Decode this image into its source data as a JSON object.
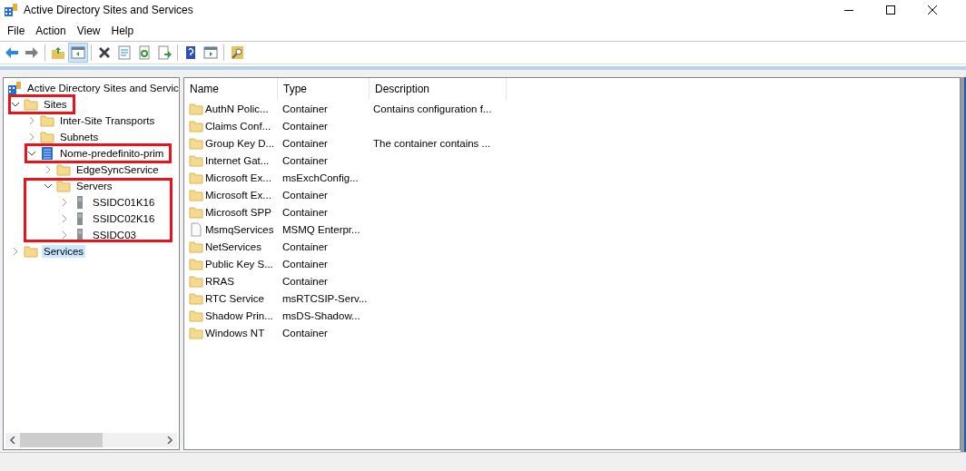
{
  "window": {
    "title": "Active Directory Sites and Services"
  },
  "menu": [
    "File",
    "Action",
    "View",
    "Help"
  ],
  "toolbar": [
    {
      "kind": "back",
      "selected": false
    },
    {
      "kind": "forward",
      "selected": false
    },
    {
      "kind": "sep"
    },
    {
      "kind": "up",
      "selected": false
    },
    {
      "kind": "pane",
      "selected": true
    },
    {
      "kind": "sep"
    },
    {
      "kind": "delete",
      "selected": false
    },
    {
      "kind": "properties",
      "selected": false
    },
    {
      "kind": "refresh",
      "selected": false
    },
    {
      "kind": "export",
      "selected": false
    },
    {
      "kind": "sep"
    },
    {
      "kind": "help",
      "selected": false
    },
    {
      "kind": "action-pane",
      "selected": false
    },
    {
      "kind": "sep"
    },
    {
      "kind": "find",
      "selected": false
    }
  ],
  "tree": {
    "label": "Active Directory Sites and Servic",
    "children": [
      {
        "label": "Sites",
        "kind": "folder",
        "expanded": true,
        "selected": false,
        "highlighted": true,
        "children": [
          {
            "label": "Inter-Site Transports",
            "kind": "folder",
            "expanded": false,
            "selected": false
          },
          {
            "label": "Subnets",
            "kind": "folder",
            "expanded": false,
            "selected": false
          },
          {
            "label": "Nome-predefinito-prim",
            "kind": "site",
            "expanded": true,
            "selected": false,
            "highlighted": true,
            "children": [
              {
                "label": "EdgeSyncService",
                "kind": "folder",
                "expanded": false,
                "selected": false
              },
              {
                "label": "Servers",
                "kind": "folder",
                "expanded": true,
                "selected": false,
                "branch_highlighted": true,
                "children": [
                  {
                    "label": "SSIDC01K16",
                    "kind": "server",
                    "expanded": false,
                    "selected": false
                  },
                  {
                    "label": "SSIDC02K16",
                    "kind": "server",
                    "expanded": false,
                    "selected": false
                  },
                  {
                    "label": "SSIDC03",
                    "kind": "server",
                    "expanded": false,
                    "selected": false
                  }
                ]
              }
            ]
          }
        ]
      },
      {
        "label": "Services",
        "kind": "folder",
        "expanded": false,
        "selected": true
      }
    ]
  },
  "table": {
    "columns": [
      "Name",
      "Type",
      "Description"
    ],
    "rows": [
      {
        "kind": "folder",
        "cells": [
          "AuthN Polic...",
          "Container",
          "Contains configuration f..."
        ]
      },
      {
        "kind": "folder",
        "cells": [
          "Claims Conf...",
          "Container",
          ""
        ]
      },
      {
        "kind": "folder",
        "cells": [
          "Group Key D...",
          "Container",
          "The container contains ..."
        ]
      },
      {
        "kind": "folder",
        "cells": [
          "Internet Gat...",
          "Container",
          ""
        ]
      },
      {
        "kind": "folder",
        "cells": [
          "Microsoft Ex...",
          "msExchConfig...",
          ""
        ]
      },
      {
        "kind": "folder",
        "cells": [
          "Microsoft Ex...",
          "Container",
          ""
        ]
      },
      {
        "kind": "folder",
        "cells": [
          "Microsoft SPP",
          "Container",
          ""
        ]
      },
      {
        "kind": "file",
        "cells": [
          "MsmqServices",
          "MSMQ Enterpr...",
          ""
        ]
      },
      {
        "kind": "folder",
        "cells": [
          "NetServices",
          "Container",
          ""
        ]
      },
      {
        "kind": "folder",
        "cells": [
          "Public Key S...",
          "Container",
          ""
        ]
      },
      {
        "kind": "folder",
        "cells": [
          "RRAS",
          "Container",
          ""
        ]
      },
      {
        "kind": "folder",
        "cells": [
          "RTC Service",
          "msRTCSIP-Serv...",
          ""
        ]
      },
      {
        "kind": "folder",
        "cells": [
          "Shadow Prin...",
          "msDS-Shadow...",
          ""
        ]
      },
      {
        "kind": "folder",
        "cells": [
          "Windows NT",
          "Container",
          ""
        ]
      }
    ]
  }
}
